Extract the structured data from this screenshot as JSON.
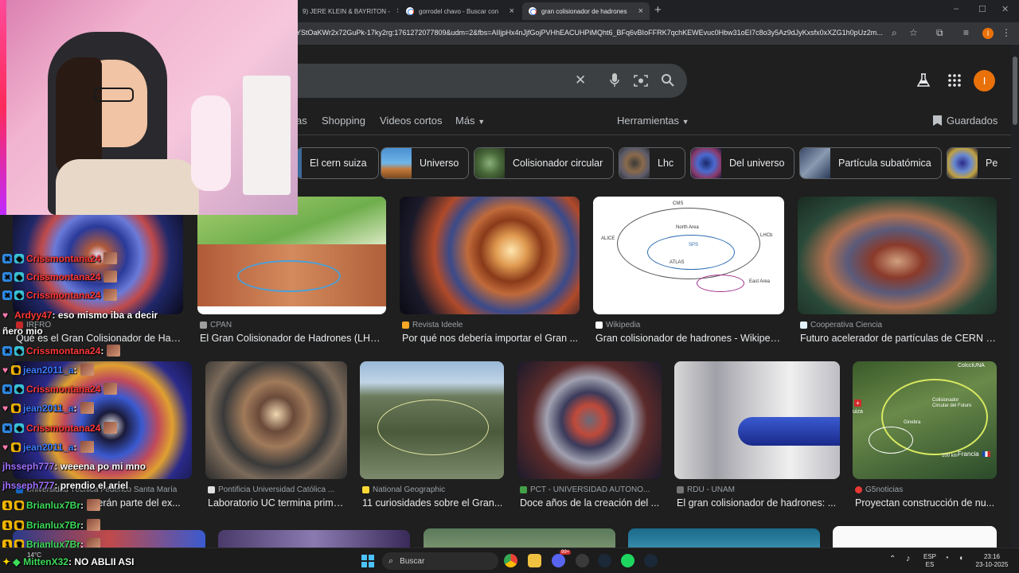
{
  "browser": {
    "tabs": [
      {
        "title": "9) JERE KLEIN & BAYRITON -",
        "close": "×"
      },
      {
        "title": "gorrodel chavo - Buscar con Go",
        "close": "×"
      },
      {
        "title": "gran colisionador de hadrones",
        "close": "×"
      }
    ],
    "new_tab": "+",
    "window": {
      "minimize": "–",
      "maximize": "☐",
      "close": "✕"
    },
    "url": "YStOaKWr2x72GuPk-17ky2rg:1761272077809&udm=2&fbs=AIIjpHx4nJjfGojPVHhEACUHPiMQht6_BFq6vBIoFFRK7qchKEWEvuc0Hbw31oEI7c8o3y5Az9dJyKxsfx0xXZG1h0pUz2m...",
    "profile_initial": "I"
  },
  "google": {
    "search_clear": "✕",
    "avatar_initial": "I",
    "nav": {
      "partial": "as",
      "shopping": "Shopping",
      "videos": "Videos cortos",
      "more": "Más",
      "tools": "Herramientas",
      "saved": "Guardados"
    },
    "chips": [
      {
        "label": "El cern suiza"
      },
      {
        "label": "Universo"
      },
      {
        "label": "Colisionador circular"
      },
      {
        "label": "Lhc"
      },
      {
        "label": "Del universo"
      },
      {
        "label": "Partícula subatómica"
      },
      {
        "label": "Pe"
      }
    ],
    "row1": [
      {
        "source": "IRFRO",
        "title": "Qué es el Gran Colisionador de Had..."
      },
      {
        "source": "CPAN",
        "title": "El Gran Colisionador de Hadrones (LHC)..."
      },
      {
        "source": "Revista Ideele",
        "title": "Por qué nos debería importar el Gran ..."
      },
      {
        "source": "Wikipedia",
        "title": "Gran colisionador de hadrones - Wikipedi..."
      },
      {
        "source": "Cooperativa Ciencia",
        "title": "Futuro acelerador de partículas de CERN s..."
      }
    ],
    "row2": [
      {
        "source": "Universidad Técnica Federico Santa María",
        "title": "...erán parte del ex..."
      },
      {
        "source": "Pontificia Universidad Católica ...",
        "title": "Laboratorio UC termina prime..."
      },
      {
        "source": "National Geographic",
        "title": "11 curiosidades sobre el Gran..."
      },
      {
        "source": "PCT - UNIVERSIDAD AUTÓNO...",
        "title": "Doce años de la creación del ..."
      },
      {
        "source": "RDU - UNAM",
        "title": "El gran colisionador de hadrones: ..."
      },
      {
        "source": "G5noticias",
        "title": "Proyectan construcción de nu..."
      }
    ],
    "map_labels": {
      "corner": "ColcciUNA",
      "title": "Colisionador Circular del Futuro",
      "suiza": "uiza",
      "francia": "Francia",
      "geneva": "Ginebra",
      "km": "100 km"
    },
    "diagram_labels": {
      "cms": "CMS",
      "north": "North Area",
      "alice": "ALICE",
      "lhcb": "LHCb",
      "atlas": "ATLAS",
      "sps": "SPS",
      "east": "East Area"
    }
  },
  "chat": {
    "messages": [
      {
        "user": "Crissmontana24",
        "text": "",
        "color": "#ff3838"
      },
      {
        "user": "Crissmontana24",
        "text": "",
        "color": "#ff3838"
      },
      {
        "user": "Crissmontana24",
        "text": "",
        "color": "#ff3838"
      },
      {
        "user": "Ardyy47",
        "text": ": eso mismo iba a decir",
        "color": "#ff3838"
      },
      {
        "user": "ñero mio",
        "text": "",
        "color": "#ffffff"
      },
      {
        "user": "Crissmontana24",
        "text": ":",
        "color": "#ff3838"
      },
      {
        "user": "jean2011_a",
        "text": ":",
        "color": "#3b7dff"
      },
      {
        "user": "Crissmontana24",
        "text": "",
        "color": "#ff3838"
      },
      {
        "user": "jean2011_a",
        "text": ":",
        "color": "#3b7dff"
      },
      {
        "user": "Crissmontana24",
        "text": "",
        "color": "#ff3838"
      },
      {
        "user": "jean2011_a",
        "text": ":",
        "color": "#3b7dff"
      },
      {
        "user": "jhsseph777",
        "text": ": weeena po mi mno",
        "color": "#a070ff"
      },
      {
        "user": "jhsseph777",
        "text": ": prendio el ariel",
        "color": "#a070ff"
      },
      {
        "user": "Brianlux7Br",
        "text": ":",
        "color": "#3cdc5a"
      },
      {
        "user": "Brianlux7Br",
        "text": ":",
        "color": "#3cdc5a"
      },
      {
        "user": "Brianlux7Br",
        "text": ":",
        "color": "#3cdc5a"
      },
      {
        "user": "MittenX32",
        "text": ": NO ABLII ASI",
        "color": "#3cdc5a"
      }
    ]
  },
  "taskbar": {
    "weather": "14°C",
    "search_placeholder": "Buscar",
    "lang_top": "ESP",
    "lang_bottom": "ES",
    "time": "23:16",
    "date": "23-10-2025",
    "notif_count": "99+"
  },
  "colors": {
    "accent": "#e8710a",
    "bg": "#1f1f1f",
    "chip_border": "#5f6368"
  }
}
